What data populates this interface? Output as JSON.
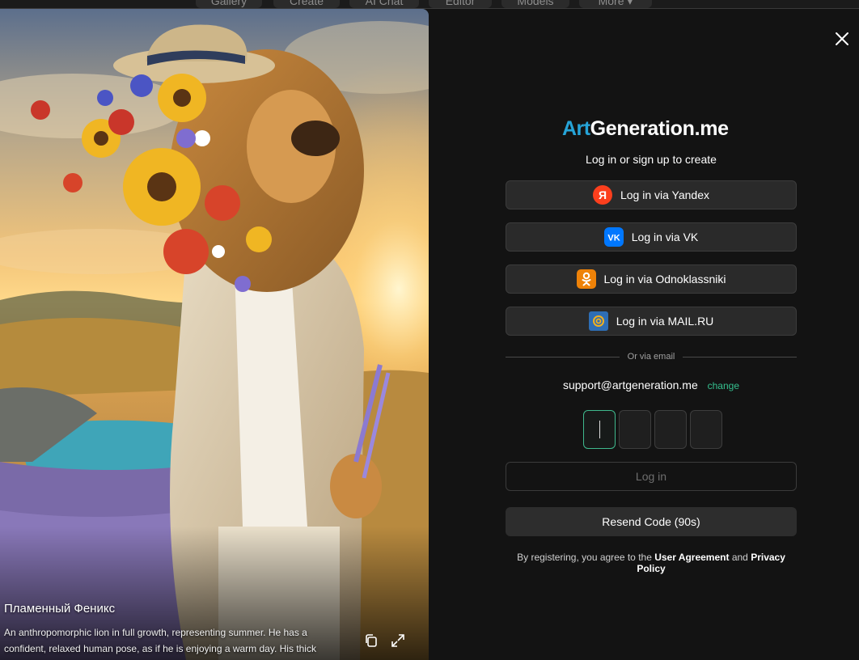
{
  "nav": {
    "items": [
      "Gallery",
      "Create",
      "AI Chat",
      "Editor",
      "Models",
      "More"
    ]
  },
  "image": {
    "title": "Пламенный Феникс",
    "description": "An anthropomorphic lion in full growth, representing summer. He has a confident, relaxed human pose, as if he is enjoying a warm day. His thick man..."
  },
  "modal": {
    "logo_art": "Art",
    "logo_rest": "Generation.me",
    "subtitle": "Log in or sign up to create",
    "buttons": {
      "yandex": "Log in via Yandex",
      "vk": "Log in via VK",
      "ok": "Log in via Odnoklassniki",
      "mail": "Log in via MAIL.RU"
    },
    "divider": "Or via email",
    "email": "support@artgeneration.me",
    "change": "change",
    "login": "Log in",
    "resend": "Resend Code (90s)",
    "terms_prefix": "By registering, you agree to the ",
    "terms_link1": "User Agreement",
    "terms_and": " and ",
    "terms_link2": "Privacy Policy"
  },
  "colors": {
    "accent_green": "#35c08f",
    "yandex_red": "#fc3f1d",
    "vk_blue": "#0077ff",
    "ok_orange": "#ee8208",
    "mail_blue": "#2e6eb5",
    "logo_blue": "#26a4d8"
  },
  "icons": {
    "close": "close-icon",
    "copy": "copy-icon",
    "expand": "expand-icon"
  }
}
